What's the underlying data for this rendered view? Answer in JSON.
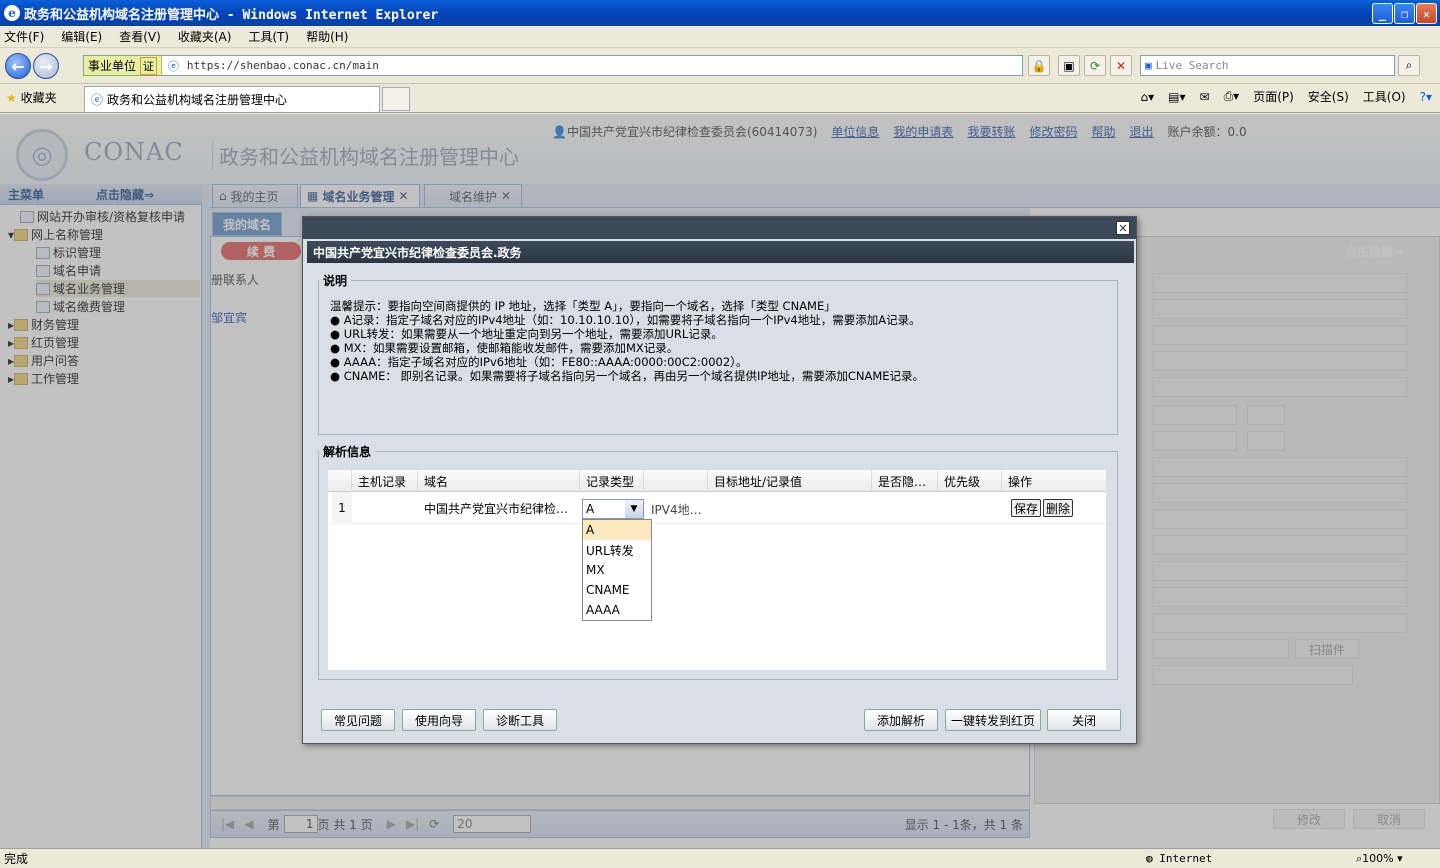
{
  "window": {
    "title": "政务和公益机构域名注册管理中心 - Windows Internet Explorer"
  },
  "menu": [
    "文件(F)",
    "编辑(E)",
    "查看(V)",
    "收藏夹(A)",
    "工具(T)",
    "帮助(H)"
  ],
  "address": {
    "cert_label": "事业单位",
    "cert_badge": "证",
    "url": "https://shenbao.conac.cn/main",
    "search_placeholder": "Live Search"
  },
  "tabbar": {
    "favorites": "收藏夹",
    "tab_title": "政务和公益机构域名注册管理中心",
    "tools": [
      "页面(P)",
      "安全(S)",
      "工具(O)"
    ]
  },
  "header": {
    "brand": "CONAC",
    "title": "政务和公益机构域名注册管理中心",
    "account": "中国共产党宜兴市纪律检查委员会(60414073)",
    "links": [
      "单位信息",
      "我的申请表",
      "我要转账",
      "修改密码",
      "帮助",
      "退出"
    ],
    "balance": "账户余额：0.0"
  },
  "sidebar": {
    "title": "主菜单",
    "hide": "点击隐藏⇒",
    "items": [
      "网站开办审核/资格复核申请",
      "网上名称管理",
      "标识管理",
      "域名申请",
      "域名业务管理",
      "域名缴费管理",
      "财务管理",
      "红页管理",
      "用户问答",
      "工作管理"
    ]
  },
  "main_tabs": [
    "我的主页",
    "域名业务管理",
    "域名维护"
  ],
  "sub_tabs": [
    "我的域名"
  ],
  "renew_btn": "续  费",
  "grid_col": "册联系人",
  "grid_cell": "邹宜宾",
  "right_hide": "点击隐藏⇒",
  "right_btns": [
    "扫描件",
    "修改",
    "取消"
  ],
  "pager": {
    "page_label": "第",
    "page": "1",
    "of": "页 共 1 页",
    "size": "20",
    "summary": "显示 1 - 1条，共 1 条"
  },
  "status": {
    "left": "完成",
    "zone": "Internet",
    "zoom": "100%"
  },
  "dialog": {
    "title": "中国共产党宜兴市纪律检查委员会.政务",
    "note_legend": "说明",
    "notes": [
      "温馨提示：要指向空间商提供的 IP 地址，选择「类型 A」，要指向一个域名，选择「类型 CNAME」",
      "●  A记录：指定子域名对应的IPv4地址（如：10.10.10.10），如需要将子域名指向一个IPv4地址，需要添加A记录。",
      "●  URL转发：如果需要从一个地址重定向到另一个地址，需要添加URL记录。",
      "●  MX：如果需要设置邮箱，使邮箱能收发邮件，需要添加MX记录。",
      "●  AAAA：指定子域名对应的IPv6地址（如：FE80::AAAA:0000:00C2:0002）。",
      "●  CNAME： 即别名记录。如果需要将子域名指向另一个域名，再由另一个域名提供IP地址，需要添加CNAME记录。"
    ],
    "grid_legend": "解析信息",
    "columns": [
      "主机记录",
      "域名",
      "记录类型",
      "",
      "目标地址/记录值",
      "是否隐…",
      "优先级",
      "操作"
    ],
    "row": {
      "num": "1",
      "domain": "中国共产党宜兴市纪律检…",
      "type": "A",
      "hint": "IPV4地…",
      "save": "保存",
      "delete": "删除"
    },
    "type_options": [
      "A",
      "URL转发",
      "MX",
      "CNAME",
      "AAAA"
    ],
    "buttons_left": [
      "常见问题",
      "使用向导",
      "诊断工具"
    ],
    "buttons_right": [
      "添加解析",
      "一键转发到红页",
      "关闭"
    ]
  }
}
